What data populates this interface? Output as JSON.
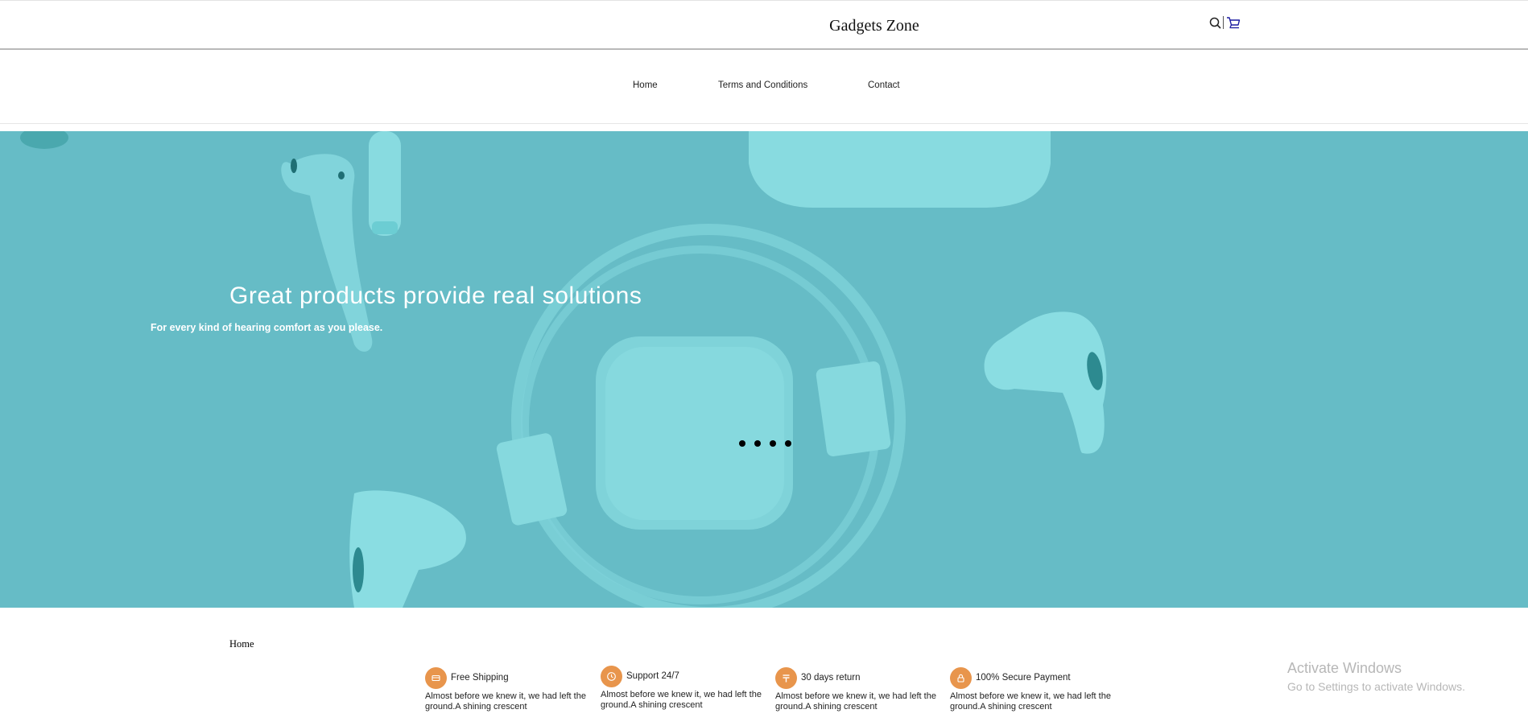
{
  "header": {
    "brand": "Gadgets Zone"
  },
  "nav": {
    "items": [
      {
        "label": "Home"
      },
      {
        "label": "Terms and Conditions"
      },
      {
        "label": "Contact"
      }
    ]
  },
  "hero": {
    "title": "Great products provide real solutions",
    "subtitle": "For every kind of hearing comfort as you please.",
    "slide_count": 4,
    "overlay_color": "#66bcc6"
  },
  "breadcrumb": {
    "home": "Home"
  },
  "features": [
    {
      "icon": "truck-icon",
      "title": "Free Shipping",
      "desc": "Almost before we knew it, we had left the ground.A shining crescent"
    },
    {
      "icon": "clock-icon",
      "title": "Support 24/7",
      "desc": "Almost before we knew it, we had left the ground.A shining crescent"
    },
    {
      "icon": "currency-icon",
      "title": "30 days return",
      "desc": "Almost before we knew it, we had left the ground.A shining crescent"
    },
    {
      "icon": "lock-icon",
      "title": "100% Secure Payment",
      "desc": "Almost before we knew it, we had left the ground.A shining crescent"
    }
  ],
  "watermark": {
    "line1": "Activate Windows",
    "line2": "Go to Settings to activate Windows."
  },
  "colors": {
    "accent": "#e8954c",
    "hero_bg": "#66bcc6",
    "cart_icon": "#1a1aa0"
  }
}
